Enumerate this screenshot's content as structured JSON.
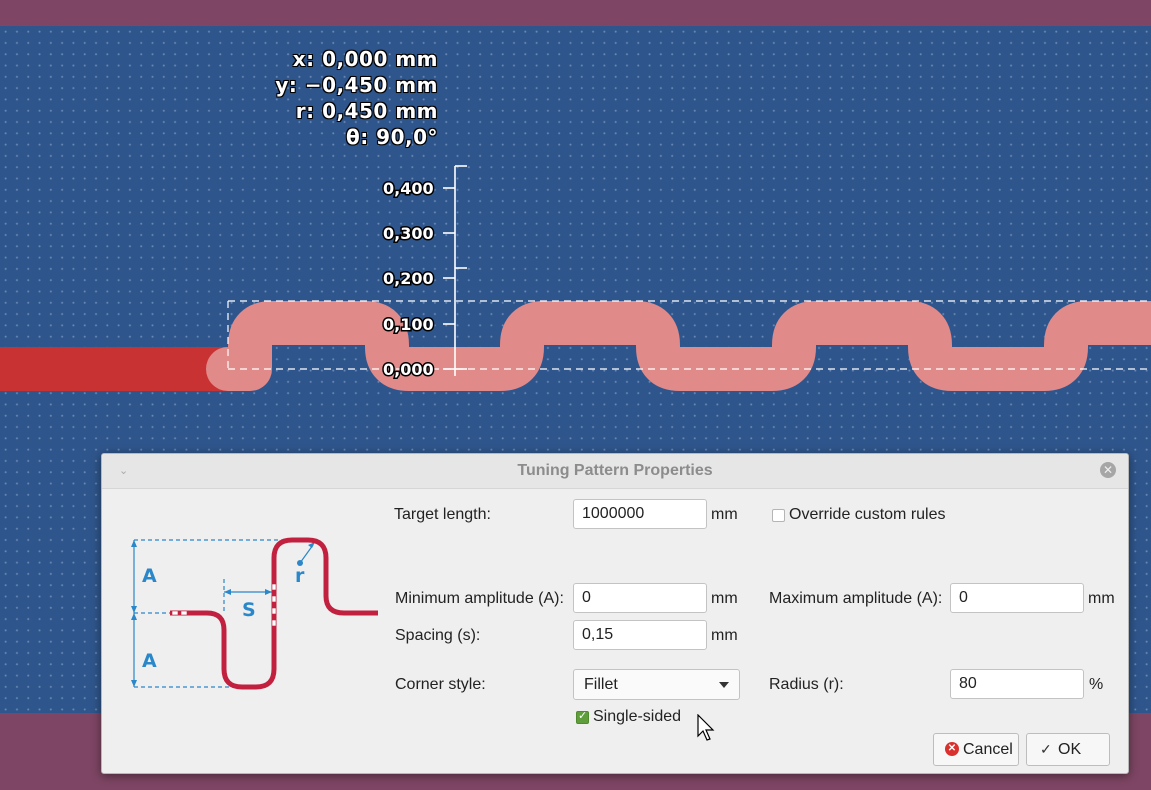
{
  "readout": {
    "x": "x: 0,000 mm",
    "y": "y: −0,450 mm",
    "r": "r: 0,450 mm",
    "theta": "θ: 90,0°"
  },
  "ruler": {
    "ticks": [
      "0,400",
      "0,300",
      "0,200",
      "0,100",
      "0,000"
    ]
  },
  "colors": {
    "canvas_bg": "#2f568c",
    "band": "#7e4664",
    "track": "#c93232",
    "tuning_track": "#e08a8a",
    "accent_blue": "#2a87c9",
    "diagram_trace": "#c2203f"
  },
  "dialog": {
    "title": "Tuning Pattern Properties",
    "diagram_labels": {
      "amp_top": "A",
      "amp_bottom": "A",
      "spacing": "S",
      "radius": "r"
    },
    "target_length": {
      "label": "Target length:",
      "value": "1000000",
      "unit": "mm"
    },
    "override": {
      "label": "Override custom rules",
      "checked": false
    },
    "min_amplitude": {
      "label": "Minimum amplitude (A):",
      "value": "0",
      "unit": "mm"
    },
    "max_amplitude": {
      "label": "Maximum amplitude (A):",
      "value": "0",
      "unit": "mm"
    },
    "spacing": {
      "label": "Spacing (s):",
      "value": "0,15",
      "unit": "mm"
    },
    "corner_style": {
      "label": "Corner style:",
      "value": "Fillet"
    },
    "radius": {
      "label": "Radius (r):",
      "value": "80",
      "unit": "%"
    },
    "single_sided": {
      "label": "Single-sided",
      "checked": true
    },
    "buttons": {
      "cancel": "Cancel",
      "ok": "OK"
    }
  }
}
